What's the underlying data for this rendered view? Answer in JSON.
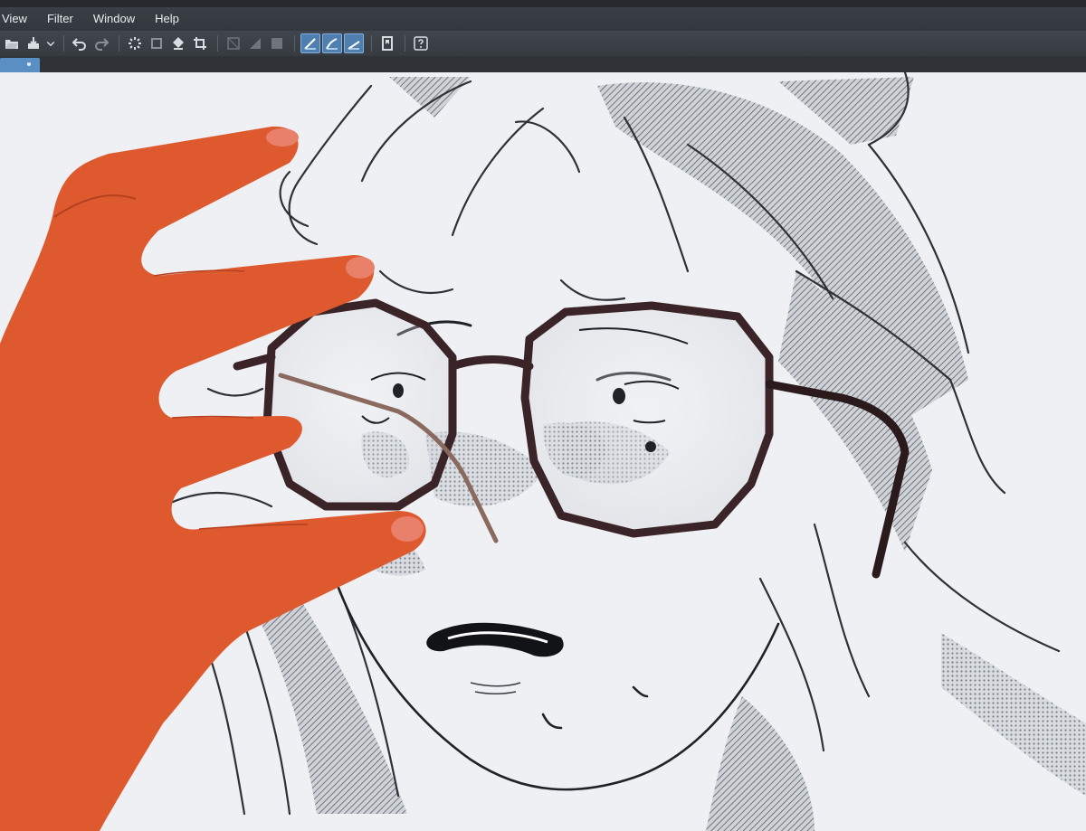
{
  "menu": {
    "items": [
      "View",
      "Filter",
      "Window",
      "Help"
    ]
  },
  "toolbar": {
    "groups": [
      [
        "open-icon",
        "save-icon",
        "dropdown-arrow-icon"
      ],
      [
        "undo-icon",
        "redo-icon"
      ],
      [
        "loading-icon",
        "clear-icon",
        "fill-icon",
        "crop-icon"
      ],
      [
        "selection-mask-icon",
        "gradient-icon",
        "frame-icon"
      ],
      [
        "ruler-snap-icon",
        "special-ruler-snap-icon",
        "grid-snap-icon"
      ],
      [
        "bookmark-icon"
      ],
      [
        "help-icon"
      ]
    ],
    "active": [
      "ruler-snap-icon",
      "special-ruler-snap-icon",
      "grid-snap-icon"
    ]
  },
  "colors": {
    "ui_dark": "#2f3338",
    "accent": "#5a8fc4",
    "canvas": "#eef0f3",
    "skin": "#e0562c",
    "glasses_frame": "#3a2427"
  }
}
